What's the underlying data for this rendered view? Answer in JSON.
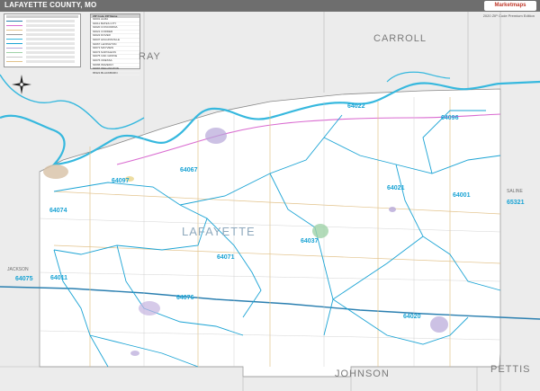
{
  "header": {
    "title": "LAFAYETTE COUNTY, MO",
    "brand": "Marketmaps"
  },
  "edition_note": "2020 ZIP Code Premium Edition",
  "county_main": "LAFAYETTE",
  "neighbors": {
    "carroll": "CARROLL",
    "ray": "RAY",
    "johnson": "JOHNSON",
    "pettis": "PETTIS",
    "saline": "SALINE",
    "jackson": "JACKSON"
  },
  "zip_labels": {
    "z64022": "64022",
    "z64096": "64096",
    "z64067": "64067",
    "z64097": "64097",
    "z64074": "64074",
    "z64021": "64021",
    "z64001": "64001",
    "z65321": "65321",
    "z64037": "64037",
    "z64071": "64071",
    "z64075": "64075",
    "z64076": "64076",
    "z64020": "64020",
    "z64011": "64011"
  },
  "zip_table": {
    "header": "ZIP Code   ZIP Name",
    "rows": [
      "64001  ALMA",
      "64011  BATES CITY",
      "64020  CONCORDIA",
      "64021  CORDER",
      "64022  DOVER",
      "64037  HIGGINSVILLE",
      "64067  LEXINGTON",
      "64071  MAYVIEW",
      "64074  NAPOLEON",
      "64075  OAK GROVE",
      "64076  ODESSA",
      "64096  WAVERLY",
      "64097  WELLINGTON",
      "65321  BLACKBURN"
    ]
  },
  "colors": {
    "river": "#36b8de",
    "zip_boundary": "#1aa3d4",
    "county_fill": "#ffffff",
    "outside_fill": "#ececec",
    "interstate": "#2a7fb0",
    "highway_pink": "#d96ad0",
    "road_tan": "#e2c28a"
  }
}
